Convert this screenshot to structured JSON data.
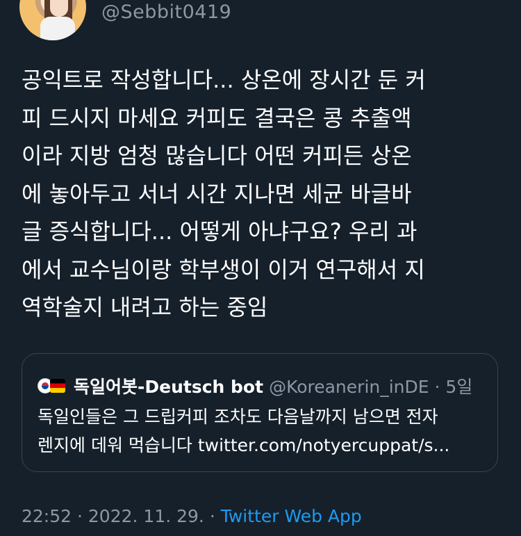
{
  "author": {
    "handle": "@Sebbit0419"
  },
  "tweet": {
    "text": "공익트로 작성합니다... 상온에 장시간 둔 커\n피 드시지 마세요 커피도 결국은 콩 추출액\n이라 지방 엄청 많습니다 어떤 커피든 상온\n에 놓아두고 서너 시간 지나면 세균 바글바\n글 증식합니다... 어떻게 아냐구요? 우리 과\n에서 교수님이랑 학부생이 이거 연구해서 지\n역학술지 내려고 하는 중임"
  },
  "quote": {
    "flag_icons": [
      "south-korea-flag-icon",
      "germany-flag-icon"
    ],
    "name": "독일어봇-Deutsch bot",
    "meta": "@Koreanerin_inDE · 5일",
    "text": "독일인들은 그 드립커피 조차도 다음날까지 남으면 전자\n렌지에 데워 먹습니다 twitter.com/notyercuppat/s..."
  },
  "footer": {
    "time": "22:52",
    "separator1": " · ",
    "date": "2022. 11. 29.",
    "separator2": " · ",
    "app": "Twitter Web App"
  },
  "colors": {
    "background": "#15202b",
    "secondary_text": "#8b98a5",
    "link": "#1d9bf0",
    "border": "#38444d"
  }
}
